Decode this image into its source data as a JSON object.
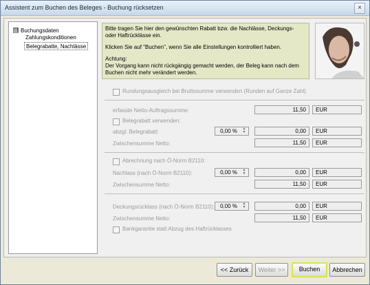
{
  "window": {
    "title": "Assistent zum Buchen des Beleges - Buchung rücksetzen",
    "close_glyph": "×"
  },
  "tree": {
    "root": "Buchungsdaten",
    "expander": "⊟",
    "items": [
      "Zahlungskonditionen",
      "Belegrabatte, Nachlässe"
    ]
  },
  "info": {
    "line1": "Bitte tragen Sie hier den gewünschten Rabatt bzw. die Nachlässe, Deckungs- oder Haftrücklässe ein.",
    "line2": "Klicken Sie auf \"Buchen\", wenn Sie alle Einstellungen kontrolliert haben.",
    "warn_title": "Achtung:",
    "warn_text": "Der Vorgang kann nicht rückgängig gemacht werden, der Beleg kann nach dem Buchen nicht mehr verändert werden."
  },
  "form": {
    "rundung": "Rundungsausgleich bei Bruttosumme verwenden (Runden auf Ganze Zahl)",
    "netto_label": "erfasste Netto-Auftragssumme:",
    "netto_value": "11,50",
    "currency": "EUR",
    "belegrabatt_check": "Belegrabatt verwenden:",
    "belegrabatt_label": "abzgl. Belegrabatt:",
    "belegrabatt_pct": "0,00 %",
    "belegrabatt_value": "0,00",
    "zwischen1_label": "Zwischensumme Netto:",
    "zwischen1_value": "11,50",
    "oenorm_check": "Abrechnung nach Ö-Norm B2110:",
    "nachlass_label": "Nachlass (nach Ö-Norm B2110):",
    "nachlass_pct": "0,00 %",
    "nachlass_value": "0,00",
    "zwischen2_label": "Zwischensumme Netto:",
    "zwischen2_value": "11,50",
    "deckung_label": "Deckungsrücklass (nach Ö-Norm B2110):",
    "deckung_pct": "0,00 %",
    "deckung_value": "0,00",
    "zwischen3_label": "Zwischensumme Netto:",
    "zwischen3_value": "11,50",
    "bankgarantie": "Bankgarantie statt Abzug des Haftrücklasses"
  },
  "buttons": {
    "back": "<< Zurück",
    "next": "Weiter >>",
    "book": "Buchen",
    "cancel": "Abbrechen"
  }
}
